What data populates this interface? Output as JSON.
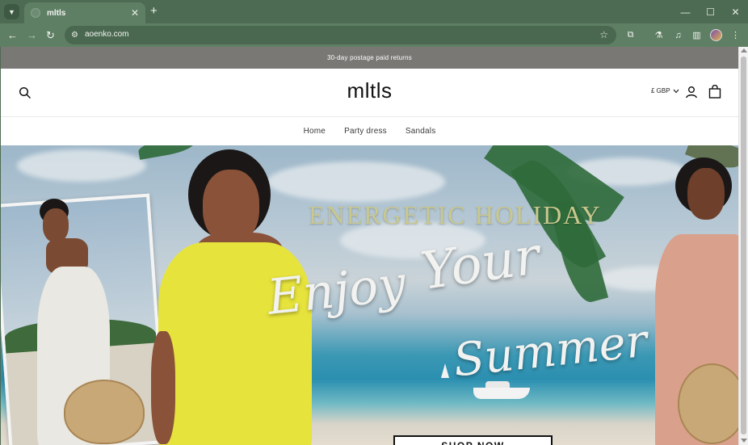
{
  "browser": {
    "tab_title": "mltls",
    "new_tab_glyph": "+",
    "close_tab_glyph": "✕",
    "url": "aoenko.com",
    "icons": [
      "tab-search-icon",
      "back-icon",
      "forward-icon",
      "reload-icon",
      "site-info-icon",
      "bookmark-star-icon",
      "extensions-icon",
      "labs-icon",
      "media-controls-icon",
      "side-panel-icon",
      "profile-avatar-icon",
      "more-menu-icon"
    ]
  },
  "store": {
    "announcement": "30-day postage paid returns",
    "logo": "mltls",
    "currency": "£ GBP",
    "menu": [
      "Home",
      "Party dress",
      "Sandals"
    ]
  },
  "hero": {
    "headline": "ENERGETIC HOLIDAY",
    "script_line_1": "Enjoy",
    "script_line_2": "Your",
    "script_line_3": "Summer",
    "cta": "SHOP NOW"
  },
  "colors": {
    "browser_frame": "#4d6b52",
    "toolbar": "#5f7f64",
    "announcement_bg": "#7a7875",
    "headline": "#c9c88e"
  }
}
